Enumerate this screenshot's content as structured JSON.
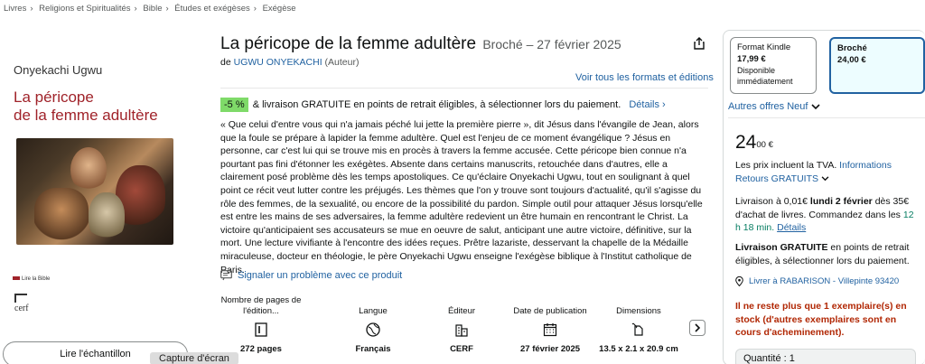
{
  "breadcrumb": [
    "Livres",
    "Religions et Spiritualités",
    "Bible",
    "Études et exégèses",
    "Exégèse"
  ],
  "cover": {
    "author": "Onyekachi Ugwu",
    "title_line1": "La péricope",
    "title_line2": "de la femme adultère",
    "series": "Lire la Bible",
    "publisher": "cerf"
  },
  "sample_button": "Lire l'échantillon",
  "capture_tooltip": "Capture d'écran",
  "product": {
    "title": "La péricope de la femme adultère",
    "format_date": "Broché – 27 février 2025",
    "by": "de",
    "author_link": "UGWU ONYEKACHI",
    "author_role": "(Auteur)",
    "all_formats": "Voir tous les formats et éditions"
  },
  "promo": {
    "badge": "-5 %",
    "text": "& livraison GRATUITE en points de retrait éligibles, à sélectionner lors du paiement.",
    "details": "Détails ›"
  },
  "description": "« Que celui d'entre vous qui n'a jamais péché lui jette la première pierre », dit Jésus dans l'évangile de Jean, alors que la foule se prépare à lapider la femme adultère. Quel est l'enjeu de ce moment évangélique ? Jésus en personne, car c'est lui qui se trouve mis en procès à travers la femme accusée. Cette péricope bien connue n'a pourtant pas fini d'étonner les exégètes. Absente dans certains manuscrits, retouchée dans d'autres, elle a clairement posé problème dès les temps apostoliques. Ce qu'éclaire Onyekachi Ugwu, tout en soulignant à quel point ce récit veut lutter contre les préjugés. Les thèmes que l'on y trouve sont toujours d'actualité, qu'il s'agisse du rôle des femmes, de la sexualité, ou encore de la possibilité du pardon. Simple outil pour attaquer Jésus lorsqu'elle est entre les mains de ses adversaires, la femme adultère redevient un être humain en rencontrant le Christ. La victoire qu'anticipaient ses accusateurs se mue en oeuvre de salut, anticipant une autre victoire, définitive, sur la mort. Une lecture vivifiante à l'encontre des idées reçues. Prêtre lazariste, desservant la chapelle de la Médaille miraculeuse, docteur en théologie, le père Onyekachi Ugwu enseigne l'exégèse biblique à l'Institut catholique de Paris.",
  "report_problem": "Signaler un problème avec ce produit",
  "specs": [
    {
      "label": "Nombre de pages de l'édition...",
      "icon": "pages-icon",
      "value": "272 pages"
    },
    {
      "label": "Langue",
      "icon": "globe-icon",
      "value": "Français"
    },
    {
      "label": "Éditeur",
      "icon": "building-icon",
      "value": "CERF"
    },
    {
      "label": "Date de publication",
      "icon": "calendar-icon",
      "value": "27 février 2025"
    },
    {
      "label": "Dimensions",
      "icon": "dimensions-icon",
      "value": "13.5 x 2.1 x 20.9 cm"
    }
  ],
  "buybox": {
    "kindle": {
      "name": "Format Kindle",
      "price": "17,99 €",
      "sub": "Disponible immédiatement"
    },
    "broche": {
      "name": "Broché",
      "price": "24,00 €"
    },
    "other_offers": "Autres offres Neuf",
    "price_whole": "24",
    "price_fraction": "00 €",
    "tva": "Les prix incluent la TVA.",
    "informations": "Informations",
    "retours": "Retours GRATUITS",
    "delivery_prefix": "Livraison à 0,01€",
    "delivery_date": "lundi 2 février",
    "delivery_suffix": "dès 35€ d'achat de livres. Commandez dans les",
    "countdown": "12 h 18 min.",
    "details": "Détails",
    "free_delivery_bold": "Livraison GRATUITE",
    "free_delivery_rest": "en points de retrait éligibles, à sélectionner lors du paiement.",
    "deliver_to": "Livrer à RABARISON - Villepinte 93420",
    "stock": "Il ne reste plus que 1 exemplaire(s) en stock (d'autres exemplaires sont en cours d'acheminement).",
    "quantity": "Quantité : 1"
  },
  "colors": {
    "link": "#2162a1",
    "badge": "#7fda69",
    "stock": "#b12704",
    "cover_title": "#a0232a"
  }
}
